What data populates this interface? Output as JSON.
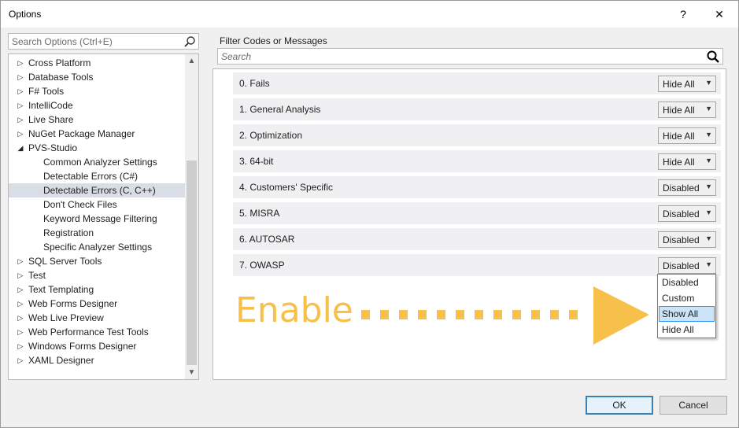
{
  "window": {
    "title": "Options",
    "help_label": "?",
    "close_label": "✕"
  },
  "left_search": {
    "placeholder": "Search Options (Ctrl+E)"
  },
  "tree": [
    {
      "label": "Cross Platform",
      "level": 0,
      "expanded": false,
      "selected": false
    },
    {
      "label": "Database Tools",
      "level": 0,
      "expanded": false,
      "selected": false
    },
    {
      "label": "F# Tools",
      "level": 0,
      "expanded": false,
      "selected": false
    },
    {
      "label": "IntelliCode",
      "level": 0,
      "expanded": false,
      "selected": false
    },
    {
      "label": "Live Share",
      "level": 0,
      "expanded": false,
      "selected": false
    },
    {
      "label": "NuGet Package Manager",
      "level": 0,
      "expanded": false,
      "selected": false
    },
    {
      "label": "PVS-Studio",
      "level": 0,
      "expanded": true,
      "selected": false
    },
    {
      "label": "Common Analyzer Settings",
      "level": 1,
      "selected": false
    },
    {
      "label": "Detectable Errors (C#)",
      "level": 1,
      "selected": false
    },
    {
      "label": "Detectable Errors (C, C++)",
      "level": 1,
      "selected": true
    },
    {
      "label": "Don't Check Files",
      "level": 1,
      "selected": false
    },
    {
      "label": "Keyword Message Filtering",
      "level": 1,
      "selected": false
    },
    {
      "label": "Registration",
      "level": 1,
      "selected": false
    },
    {
      "label": "Specific Analyzer Settings",
      "level": 1,
      "selected": false
    },
    {
      "label": "SQL Server Tools",
      "level": 0,
      "expanded": false,
      "selected": false
    },
    {
      "label": "Test",
      "level": 0,
      "expanded": false,
      "selected": false
    },
    {
      "label": "Text Templating",
      "level": 0,
      "expanded": false,
      "selected": false
    },
    {
      "label": "Web Forms Designer",
      "level": 0,
      "expanded": false,
      "selected": false
    },
    {
      "label": "Web Live Preview",
      "level": 0,
      "expanded": false,
      "selected": false
    },
    {
      "label": "Web Performance Test Tools",
      "level": 0,
      "expanded": false,
      "selected": false
    },
    {
      "label": "Windows Forms Designer",
      "level": 0,
      "expanded": false,
      "selected": false
    },
    {
      "label": "XAML Designer",
      "level": 0,
      "expanded": false,
      "selected": false
    }
  ],
  "filter": {
    "label": "Filter Codes or Messages",
    "placeholder": "Search"
  },
  "groups": [
    {
      "name": "0. Fails",
      "value": "Hide All"
    },
    {
      "name": "1. General Analysis",
      "value": "Hide All"
    },
    {
      "name": "2. Optimization",
      "value": "Hide All"
    },
    {
      "name": "3. 64-bit",
      "value": "Hide All"
    },
    {
      "name": "4. Customers' Specific",
      "value": "Disabled"
    },
    {
      "name": "5. MISRA",
      "value": "Disabled"
    },
    {
      "name": "6. AUTOSAR",
      "value": "Disabled"
    },
    {
      "name": "7. OWASP",
      "value": "Disabled"
    }
  ],
  "dropdown": {
    "options": [
      "Disabled",
      "Custom",
      "Show All",
      "Hide All"
    ],
    "highlighted": "Show All"
  },
  "annotation": {
    "text": "Enable",
    "color": "#f7c04a"
  },
  "buttons": {
    "ok": "OK",
    "cancel": "Cancel"
  }
}
